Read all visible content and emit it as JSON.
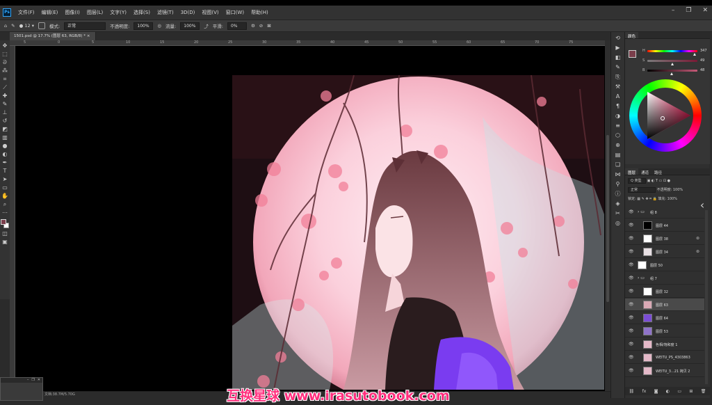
{
  "app": {
    "name": "Photoshop",
    "logo_text": "Ps"
  },
  "menu": [
    "文件(F)",
    "编辑(E)",
    "图像(I)",
    "图层(L)",
    "文字(Y)",
    "选择(S)",
    "滤镜(T)",
    "3D(D)",
    "视图(V)",
    "窗口(W)",
    "帮助(H)"
  ],
  "window_controls": {
    "minimize": "–",
    "restore": "❐",
    "close": "✕"
  },
  "options": {
    "brush_size": "12",
    "mode_label": "模式:",
    "mode_value": "正常",
    "opacity_label": "不透明度:",
    "opacity_value": "100%",
    "flow_label": "流量:",
    "flow_value": "100%",
    "smooth_label": "平滑:",
    "smooth_value": "0%"
  },
  "document": {
    "tab_title": "1501.psd @ 17.7% (图层 63, RGB/8) *",
    "status": "文档:38.7M/5.70G"
  },
  "ruler_ticks": [
    "5",
    "0",
    "5",
    "10",
    "15",
    "20",
    "25",
    "30",
    "35",
    "40",
    "45",
    "50",
    "55",
    "60",
    "65",
    "70",
    "75"
  ],
  "tools": [
    "move-icon",
    "marquee-icon",
    "lasso-icon",
    "quick-select-icon",
    "crop-icon",
    "eyedropper-icon",
    "healing-icon",
    "brush-icon",
    "stamp-icon",
    "history-brush-icon",
    "eraser-icon",
    "gradient-icon",
    "blur-icon",
    "dodge-icon",
    "pen-icon",
    "type-icon",
    "path-select-icon",
    "shape-icon",
    "hand-icon",
    "zoom-icon",
    "more-icon"
  ],
  "colors": {
    "foreground": "#7a3e4b",
    "background": "#ffffff",
    "accent": "#31a8ff",
    "watermark": "#ff2f7d"
  },
  "color_panel": {
    "tab": "颜色",
    "sliders": [
      {
        "label": "H",
        "value": "347"
      },
      {
        "label": "S",
        "value": "49"
      },
      {
        "label": "B",
        "value": "48"
      }
    ]
  },
  "layers_panel": {
    "tabs": [
      "图层",
      "通道",
      "路径"
    ],
    "filter_label": "Q 类型",
    "blend_mode": "正常",
    "opacity_label": "不透明度:",
    "opacity_value": "100%",
    "lock_label": "锁定:",
    "fill_label": "填充:",
    "fill_value": "100%",
    "layers": [
      {
        "name": "组 8",
        "type": "group",
        "indent": 0
      },
      {
        "name": "图层 44",
        "type": "layer",
        "indent": 1,
        "thumb": "#000000"
      },
      {
        "name": "图层 38",
        "type": "layer",
        "indent": 1,
        "thumb": "#ffffff",
        "fx": "⊛"
      },
      {
        "name": "图层 34",
        "type": "layer",
        "indent": 1,
        "thumb": "#e8e0e4",
        "fx": "⊛"
      },
      {
        "name": "图层 50",
        "type": "layer",
        "indent": 0,
        "thumb": "#ffffff"
      },
      {
        "name": "组 7",
        "type": "group",
        "indent": 0
      },
      {
        "name": "图层 32",
        "type": "layer",
        "indent": 1,
        "thumb": "#ffffff"
      },
      {
        "name": "图层 63",
        "type": "layer",
        "indent": 1,
        "thumb": "#d9a9b5",
        "selected": true
      },
      {
        "name": "图层 64",
        "type": "layer",
        "indent": 1,
        "thumb": "#7b4dd6"
      },
      {
        "name": "图层 53",
        "type": "layer",
        "indent": 1,
        "thumb": "#8f73c9"
      },
      {
        "name": "色相/饱和度 1",
        "type": "adjustment",
        "indent": 1,
        "thumb": "#e4b9c8"
      },
      {
        "name": "WEITU_PS_4303863",
        "type": "layer",
        "indent": 1,
        "thumb": "#e4b9c8"
      },
      {
        "name": "WEITU_3...21 拷贝 2",
        "type": "layer",
        "indent": 1,
        "thumb": "#e4b9c8"
      }
    ],
    "bottom_icons": [
      "link-icon",
      "fx-icon",
      "mask-icon",
      "adjustment-icon",
      "folder-icon",
      "new-layer-icon",
      "trash-icon"
    ]
  },
  "right_icons": [
    "history-icon",
    "play-icon",
    "paragraph-icon",
    "brush-settings-icon",
    "character-icon",
    "paragraph-style-icon",
    "adjust-icon",
    "3d-icon",
    "channels-icon",
    "paths-icon",
    "library-icon",
    "swatch-icon",
    "properties-icon",
    "info-icon",
    "navigator-icon",
    "tool-presets-icon",
    "clone-source-icon"
  ],
  "watermark": "互换星球 www.irasutobook.com"
}
